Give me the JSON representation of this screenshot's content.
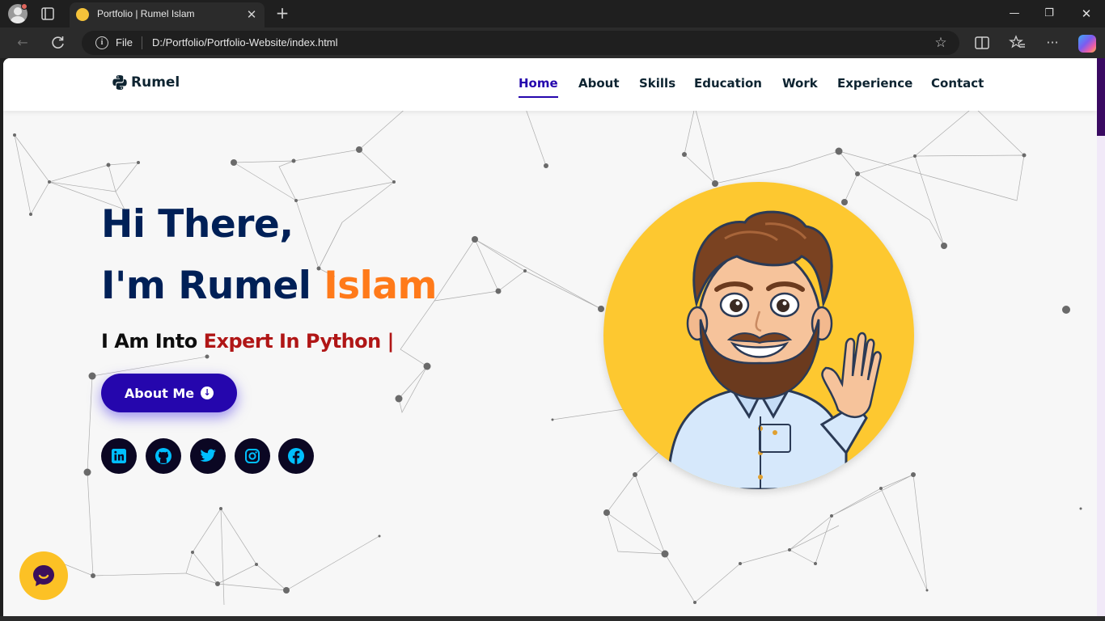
{
  "browser": {
    "tab_title": "Portfolio | Rumel Islam",
    "tab_close": "✕",
    "new_tab": "+",
    "address_scheme_label": "File",
    "url": "D:/Portfolio/Portfolio-Website/index.html",
    "window_buttons": {
      "minimize": "—",
      "restore": "❐",
      "close": "✕"
    }
  },
  "site": {
    "brand": "Rumel",
    "nav": [
      {
        "label": "Home",
        "active": true
      },
      {
        "label": "About",
        "active": false
      },
      {
        "label": "Skills",
        "active": false
      },
      {
        "label": "Education",
        "active": false
      },
      {
        "label": "Work",
        "active": false
      },
      {
        "label": "Experience",
        "active": false
      },
      {
        "label": "Contact",
        "active": false
      }
    ],
    "hero": {
      "greeting": "Hi There,",
      "intro_prefix": "I'm Rumel ",
      "intro_accent": "Islam",
      "sub_prefix": "I Am Into ",
      "sub_typed": "Expert In Python",
      "sub_cursor": " |",
      "button_label": "About Me"
    },
    "socials": [
      "linkedin-icon",
      "github-icon",
      "twitter-icon",
      "instagram-icon",
      "facebook-icon"
    ]
  },
  "colors": {
    "primary": "#2506ad",
    "heading": "#002057",
    "accent": "#ff7a1a",
    "typed": "#b01616",
    "social_bg": "#0b0723",
    "social_icon": "#00bfff",
    "avatar_bg": "#fdc830"
  }
}
